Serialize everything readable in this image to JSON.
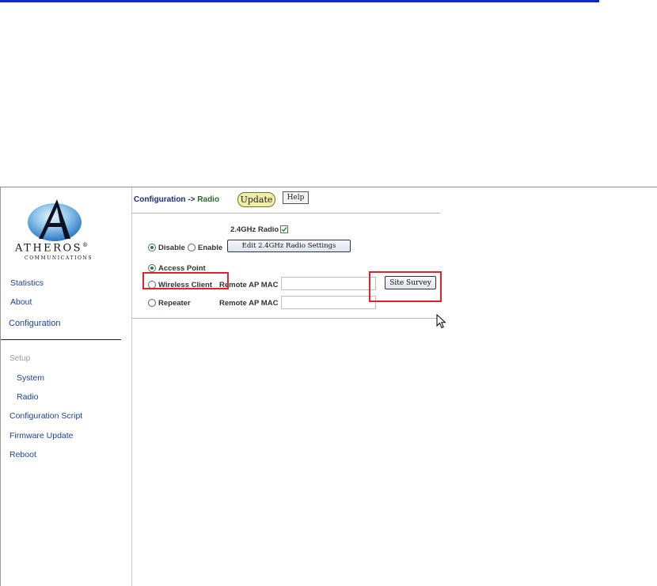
{
  "logo": {
    "wordmark": "ATHEROS",
    "registered": "®",
    "tagline": "COMMUNICATIONS"
  },
  "sidebar": {
    "items": [
      {
        "label": "Statistics"
      },
      {
        "label": "About"
      },
      {
        "label": "Configuration"
      }
    ],
    "setup_heading": "Setup",
    "setup_items": [
      {
        "label": "System"
      },
      {
        "label": "Radio"
      },
      {
        "label": "Configuration Script"
      },
      {
        "label": "Firmware Update"
      },
      {
        "label": "Reboot"
      }
    ]
  },
  "header": {
    "breadcrumb_root": "Configuration",
    "breadcrumb_arrow": "->",
    "breadcrumb_current": "Radio",
    "update_label": "Update",
    "help_label": "Help"
  },
  "radio_form": {
    "radio_24_label": "2.4GHz Radio",
    "radio_24_checked": true,
    "disable_label": "Disable",
    "enable_label": "Enable",
    "state_selected": "Disable",
    "edit_settings_label": "Edit 2.4GHz Radio Settings",
    "mode_selected": "Access Point",
    "modes": [
      {
        "label": "Access Point"
      },
      {
        "label": "Wireless Client",
        "mac_label": "Remote AP MAC",
        "mac_value": ""
      },
      {
        "label": "Repeater",
        "mac_label": "Remote AP MAC",
        "mac_value": ""
      }
    ],
    "site_survey_label": "Site Survey"
  },
  "colors": {
    "accent_blue": "#1428c8",
    "nav_link": "#1a3f9a",
    "highlight_red": "#e0222a",
    "selected_green": "#2e7d32"
  },
  "icons": [
    "atheros-globe-logo",
    "checkbox-checked-icon",
    "mouse-pointer-icon"
  ]
}
